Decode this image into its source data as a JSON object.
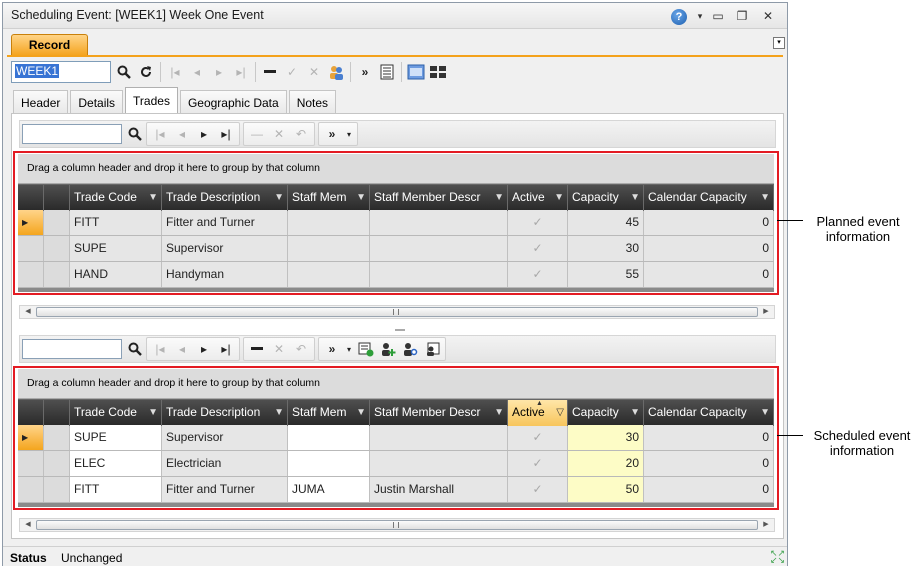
{
  "window": {
    "title": "Scheduling Event: [WEEK1] Week One Event",
    "help_icon": "?",
    "dropdown_icon": "▾",
    "minimize_icon": "▭",
    "restore_icon": "❐",
    "close_icon": "✕"
  },
  "ribbon": {
    "tab_label": "Record",
    "collapse_icon": "▾"
  },
  "main_toolbar": {
    "id_value": "WEEK1"
  },
  "tabs": [
    {
      "label": "Header"
    },
    {
      "label": "Details"
    },
    {
      "label": "Trades"
    },
    {
      "label": "Geographic Data"
    },
    {
      "label": "Notes"
    }
  ],
  "grid_common": {
    "group_hint": "Drag a column header and drop it here to group by that column"
  },
  "planned_grid": {
    "columns": [
      "Trade Code",
      "Trade Description",
      "Staff Mem",
      "Staff Member Descr",
      "Active",
      "Capacity",
      "Calendar Capacity"
    ],
    "rows": [
      {
        "code": "FITT",
        "desc": "Fitter and Turner",
        "staff": "",
        "staff_desc": "",
        "active": "✓",
        "capacity": "45",
        "cal": "0"
      },
      {
        "code": "SUPE",
        "desc": "Supervisor",
        "staff": "",
        "staff_desc": "",
        "active": "✓",
        "capacity": "30",
        "cal": "0"
      },
      {
        "code": "HAND",
        "desc": "Handyman",
        "staff": "",
        "staff_desc": "",
        "active": "✓",
        "capacity": "55",
        "cal": "0"
      }
    ]
  },
  "scheduled_grid": {
    "columns": [
      "Trade Code",
      "Trade Description",
      "Staff Mem",
      "Staff Member Descr",
      "Active",
      "Capacity",
      "Calendar Capacity"
    ],
    "rows": [
      {
        "code": "SUPE",
        "desc": "Supervisor",
        "staff": "",
        "staff_desc": "",
        "active": "✓",
        "capacity": "30",
        "cal": "0"
      },
      {
        "code": "ELEC",
        "desc": "Electrician",
        "staff": "",
        "staff_desc": "",
        "active": "✓",
        "capacity": "20",
        "cal": "0"
      },
      {
        "code": "FITT",
        "desc": "Fitter and Turner",
        "staff": "JUMA",
        "staff_desc": "Justin Marshall",
        "active": "✓",
        "capacity": "50",
        "cal": "0"
      }
    ]
  },
  "status": {
    "label": "Status",
    "value": "Unchanged"
  },
  "callouts": {
    "planned": "Planned event information",
    "scheduled": "Scheduled event information"
  },
  "colors": {
    "accent_orange": "#f4a21b",
    "highlight_red": "#e31b23",
    "edit_yellow": "#fdfcc6"
  }
}
